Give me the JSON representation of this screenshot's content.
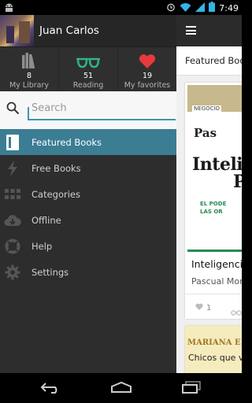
{
  "status_bar": {
    "time": "7:49",
    "icons": [
      "android-debug-icon",
      "alarm-icon",
      "wifi-icon",
      "cell-signal-icon",
      "battery-icon"
    ]
  },
  "drawer": {
    "user": {
      "name": "Juan Carlos"
    },
    "stats": [
      {
        "icon": "bookshelf-icon",
        "count": "8",
        "label": "My Library"
      },
      {
        "icon": "glasses-icon",
        "count": "51",
        "label": "Reading"
      },
      {
        "icon": "heart-icon",
        "count": "19",
        "label": "My favorites"
      }
    ],
    "search": {
      "placeholder": "Search",
      "value": ""
    },
    "menu": [
      {
        "id": "featured",
        "label": "Featured Books",
        "icon": "featured-book-icon",
        "active": true
      },
      {
        "id": "free",
        "label": "Free Books",
        "icon": "lightning-icon",
        "active": false
      },
      {
        "id": "categories",
        "label": "Categories",
        "icon": "grid-icon",
        "active": false
      },
      {
        "id": "offline",
        "label": "Offline",
        "icon": "cloud-download-icon",
        "active": false
      },
      {
        "id": "help",
        "label": "Help",
        "icon": "lifebuoy-icon",
        "active": false
      },
      {
        "id": "settings",
        "label": "Settings",
        "icon": "gear-icon",
        "active": false
      }
    ]
  },
  "content": {
    "section_title": "Featured Books",
    "featured_book": {
      "cover_logo": "NEGOCIO",
      "cover_author": "Pas",
      "cover_title_line1": "Intelig",
      "cover_title_line2": "Po",
      "cover_subtitle_line1": "EL PODE",
      "cover_subtitle_line2": "LAS OR",
      "title": "Inteligencia",
      "author": "Pascual Mont",
      "likes": "1"
    },
    "next_book": {
      "cover_author": "MARIANA E",
      "snippet": "Chicos que v"
    }
  },
  "colors": {
    "drawer_bg": "#2d2d2d",
    "active_item": "#3b7d93",
    "search_accent": "#3e94b4",
    "glasses": "#2fb38a",
    "heart": "#e8393c"
  }
}
